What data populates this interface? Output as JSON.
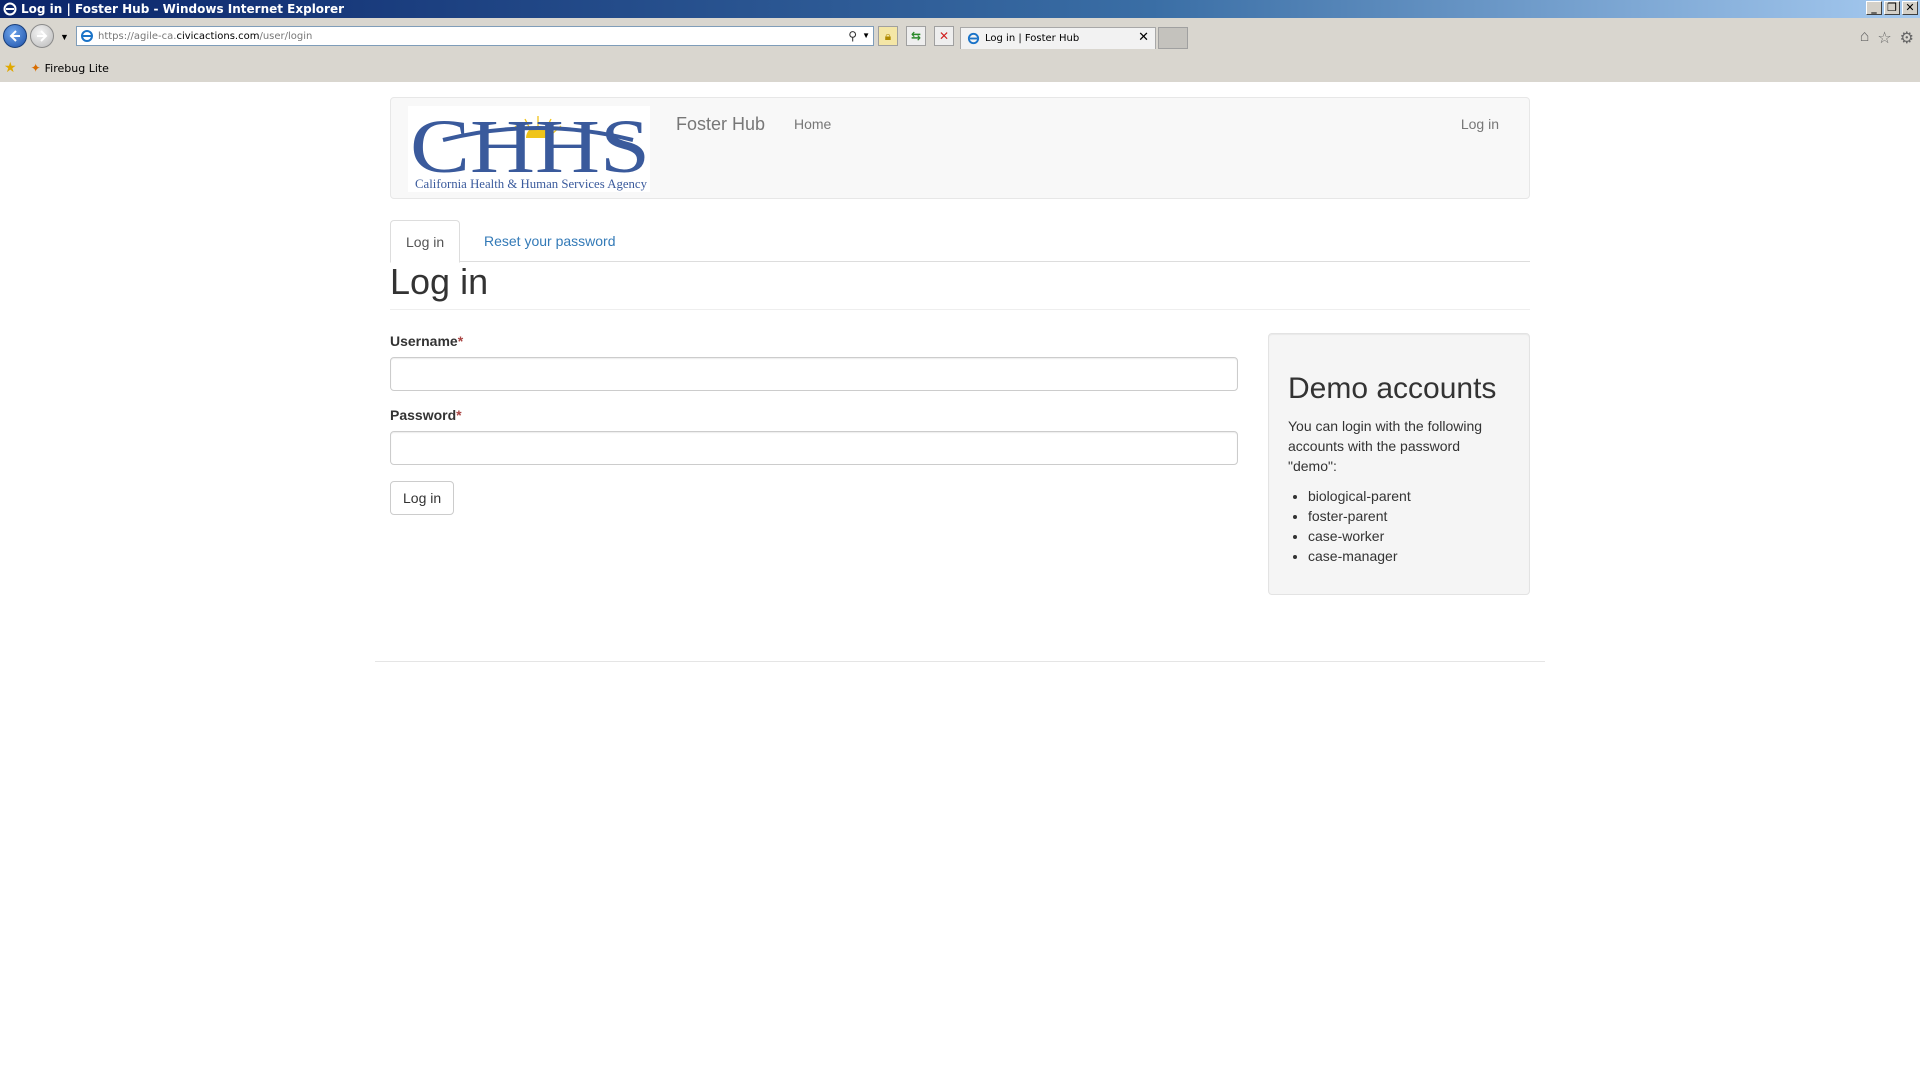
{
  "window": {
    "title": "Log in | Foster Hub - Windows Internet Explorer",
    "controls": [
      "_",
      "❐",
      "✕"
    ]
  },
  "browser": {
    "url_prefix": "https://agile-ca.",
    "url_domain": "civicactions.com",
    "url_path": "/user/login",
    "tab_title": "Log in | Foster Hub",
    "favorites": [
      {
        "label": "Firebug Lite"
      }
    ]
  },
  "site": {
    "logo_text": "CHHS",
    "logo_subtitle": "California Health & Human Services Agency",
    "name": "Foster Hub",
    "nav": {
      "home": "Home",
      "login": "Log in"
    }
  },
  "tabs": [
    {
      "label": "Log in",
      "active": true
    },
    {
      "label": "Reset your password",
      "active": false
    }
  ],
  "page_title": "Log in",
  "form": {
    "username_label": "Username",
    "password_label": "Password",
    "required_mark": "*",
    "username_value": "",
    "password_value": "",
    "submit_label": "Log in"
  },
  "demo": {
    "title": "Demo accounts",
    "text": "You can login with the following accounts with the password \"demo\":",
    "accounts": [
      "biological-parent",
      "foster-parent",
      "case-worker",
      "case-manager"
    ]
  },
  "colors": {
    "link": "#337ab7",
    "logo_blue": "#3a5a9c",
    "logo_sun": "#f0c419"
  }
}
